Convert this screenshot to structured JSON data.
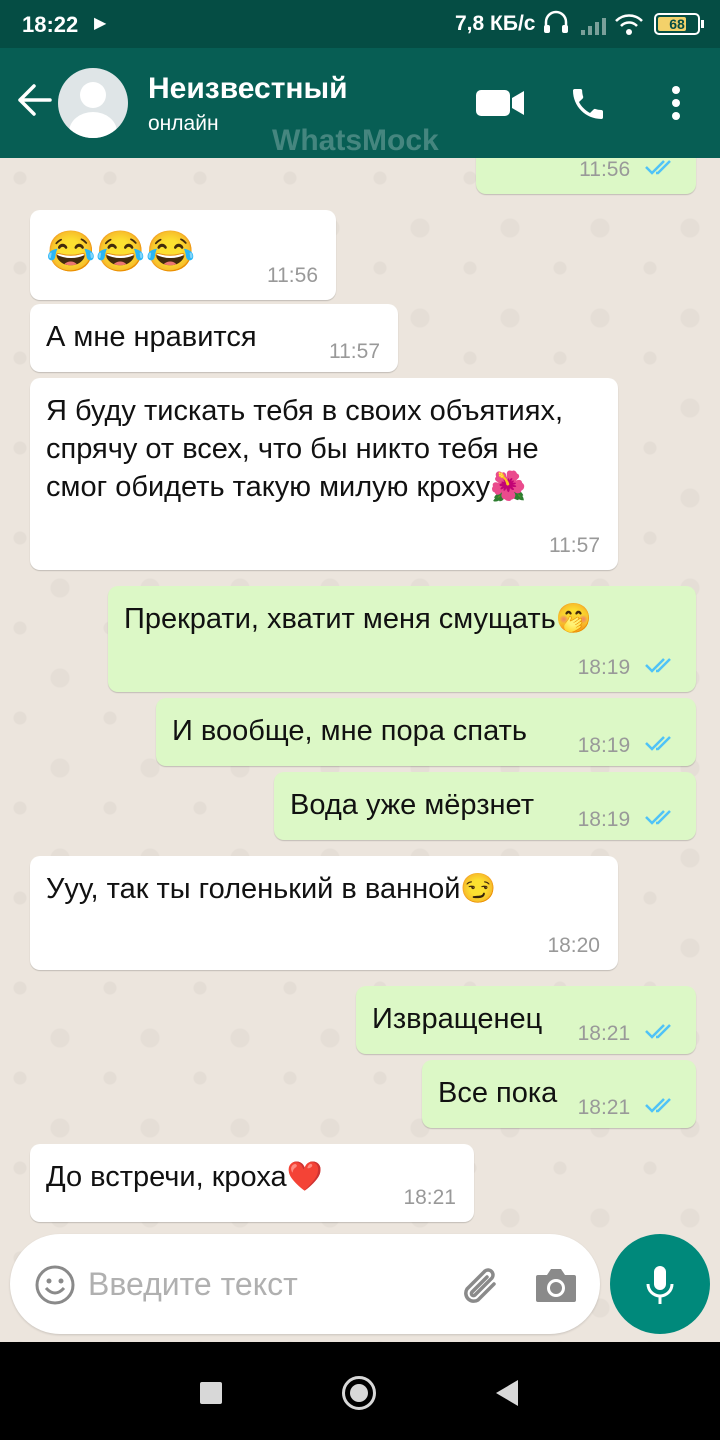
{
  "status_bar": {
    "time": "18:22",
    "play_icon": "play-icon",
    "speed": "7,8 КБ/с",
    "battery_level": "68"
  },
  "header": {
    "contact_name": "Неизвестный",
    "contact_status": "онлайн",
    "watermark": "WhatsMock",
    "icons": [
      "back-arrow-icon",
      "video-call-icon",
      "phone-icon",
      "more-vert-icon"
    ]
  },
  "messages": [
    {
      "direction": "out",
      "text": "",
      "time": "11:56",
      "read": true
    },
    {
      "direction": "in",
      "text": "😂😂😂",
      "time": "11:56"
    },
    {
      "direction": "in",
      "text": "А мне нравится",
      "time": "11:57"
    },
    {
      "direction": "in",
      "text": "Я буду тискать тебя в своих объятиях, спрячу от всех, что бы никто тебя не смог обидеть такую милую кроху🌺",
      "time": "11:57"
    },
    {
      "direction": "out",
      "text": "Прекрати, хватит меня смущать🤭",
      "time": "18:19",
      "read": true
    },
    {
      "direction": "out",
      "text": "И вообще, мне пора спать",
      "time": "18:19",
      "read": true
    },
    {
      "direction": "out",
      "text": "Вода уже мёрзнет",
      "time": "18:19",
      "read": true
    },
    {
      "direction": "in",
      "text": "Ууу, так ты голенький в ванной😏",
      "time": "18:20"
    },
    {
      "direction": "out",
      "text": "Извращенец",
      "time": "18:21",
      "read": true
    },
    {
      "direction": "out",
      "text": "Все пока",
      "time": "18:21",
      "read": true
    },
    {
      "direction": "in",
      "text": "До встречи, кроха❤️",
      "time": "18:21"
    }
  ],
  "composer": {
    "placeholder": "Введите текст",
    "value": ""
  },
  "colors": {
    "header": "#075e54",
    "status_bar": "#054d44",
    "incoming_bubble": "#ffffff",
    "outgoing_bubble": "#dcf8c6",
    "chat_background": "#ece5dd",
    "read_ticks": "#4fc3f7",
    "mic_button": "#00897b"
  }
}
